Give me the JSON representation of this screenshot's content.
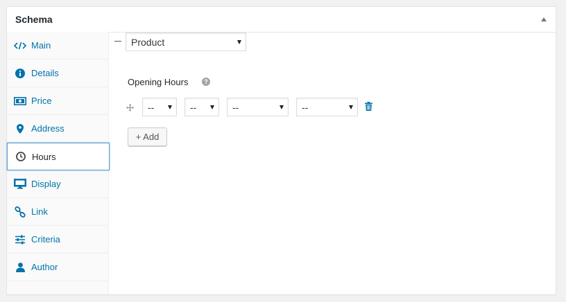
{
  "box": {
    "title": "Schema"
  },
  "sidebar": {
    "items": [
      {
        "label": "Main",
        "icon": "code-icon"
      },
      {
        "label": "Details",
        "icon": "info-icon"
      },
      {
        "label": "Price",
        "icon": "money-icon"
      },
      {
        "label": "Address",
        "icon": "location-icon"
      },
      {
        "label": "Hours",
        "icon": "clock-icon",
        "active": true
      },
      {
        "label": "Display",
        "icon": "desktop-icon"
      },
      {
        "label": "Link",
        "icon": "link-icon"
      },
      {
        "label": "Criteria",
        "icon": "sliders-icon"
      },
      {
        "label": "Author",
        "icon": "user-icon"
      }
    ]
  },
  "main": {
    "schema_type": "Product",
    "opening_hours_label": "Opening Hours",
    "help": "?",
    "hours_row": {
      "day_from": "--",
      "day_to": "--",
      "time_from": "--",
      "time_to": "--"
    },
    "add_label": "+ Add"
  },
  "colors": {
    "accent": "#0073aa",
    "focus": "#5b9dd9"
  }
}
